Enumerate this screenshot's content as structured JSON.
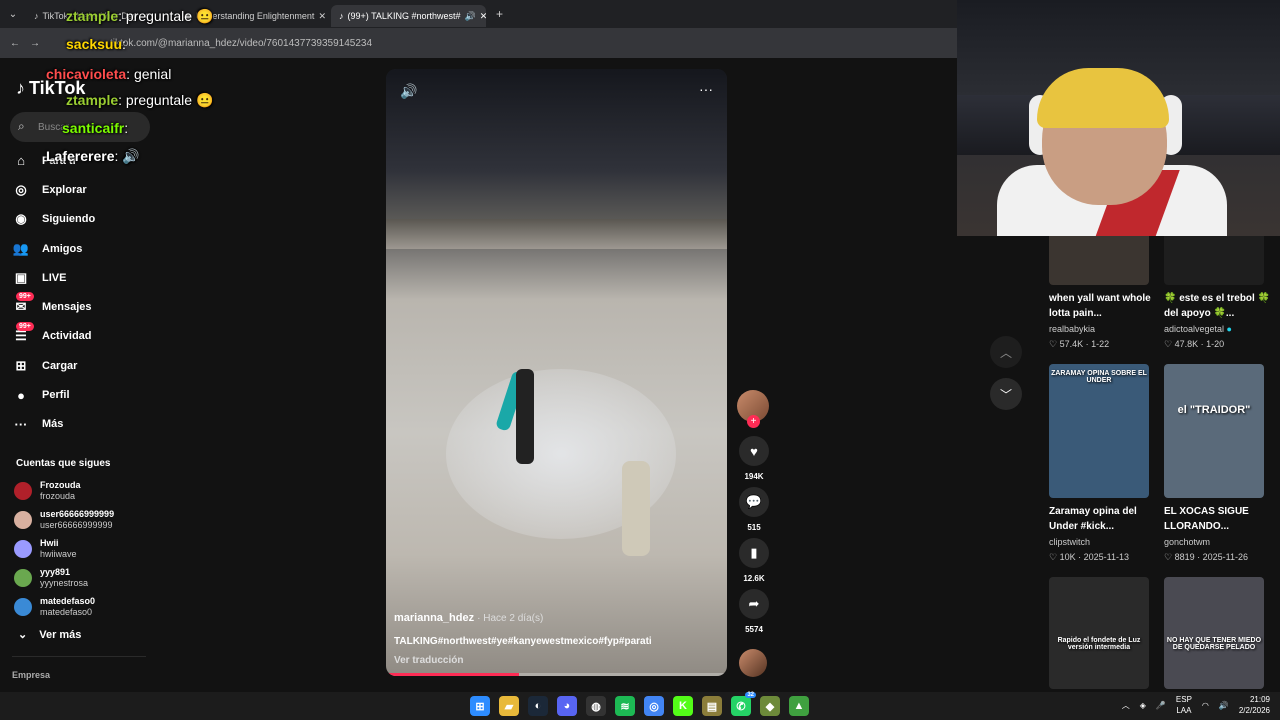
{
  "browser": {
    "tabs": [
      {
        "label": "TikTok - Make Your Day"
      },
      {
        "label": "Understanding Enlightenment"
      },
      {
        "label": "(99+) TALKING #northwest#"
      }
    ],
    "url": "tiktok.com/@marianna_hdez/video/7601437739359145234"
  },
  "chat": [
    {
      "user": "ztample",
      "msg": "preguntale 😐",
      "color": "#9acd32"
    },
    {
      "user": "sacksuu",
      "msg": "",
      "color": "#ffd700"
    },
    {
      "user": "chicavioleta",
      "msg": "genial",
      "color": "#ff4d4d"
    },
    {
      "user": "ztample",
      "msg": "preguntale 😐",
      "color": "#9acd32"
    },
    {
      "user": "santicaifr",
      "msg": "",
      "color": "#7cfc00"
    },
    {
      "user": "Lafererere",
      "msg": "🔊",
      "color": "#ffffff"
    }
  ],
  "sidebar": {
    "logo": "TikTok",
    "search_placeholder": "Buscar",
    "items": [
      {
        "label": "Para ti",
        "icon": "home-icon",
        "glyph": "⌂",
        "badge": ""
      },
      {
        "label": "Explorar",
        "icon": "compass-icon",
        "glyph": "◎",
        "badge": ""
      },
      {
        "label": "Siguiendo",
        "icon": "following-icon",
        "glyph": "◉",
        "badge": ""
      },
      {
        "label": "Amigos",
        "icon": "friends-icon",
        "glyph": "👥",
        "badge": ""
      },
      {
        "label": "LIVE",
        "icon": "live-icon",
        "glyph": "▣",
        "badge": ""
      },
      {
        "label": "Mensajes",
        "icon": "messages-icon",
        "glyph": "✉",
        "badge": "99+"
      },
      {
        "label": "Actividad",
        "icon": "activity-icon",
        "glyph": "☰",
        "badge": "99+"
      },
      {
        "label": "Cargar",
        "icon": "upload-icon",
        "glyph": "⊞",
        "badge": ""
      },
      {
        "label": "Perfil",
        "icon": "profile-icon",
        "glyph": "●",
        "badge": ""
      },
      {
        "label": "Más",
        "icon": "more-icon",
        "glyph": "···",
        "badge": ""
      }
    ],
    "following_title": "Cuentas que sigues",
    "following": [
      {
        "name": "Frozouda",
        "handle": "frozouda",
        "color": "#b0202a"
      },
      {
        "name": "user66666999999",
        "handle": "user66666999999",
        "color": "#d8b0a0"
      },
      {
        "name": "Hwii",
        "handle": "hwiiwave",
        "color": "#9a9aff"
      },
      {
        "name": "yyy891",
        "handle": "yyynestrosa",
        "color": "#6aa84f"
      },
      {
        "name": "matedefaso0",
        "handle": "matedefaso0",
        "color": "#3a8ad6"
      }
    ],
    "see_more": "Ver más",
    "footer": "Empresa"
  },
  "video": {
    "username": "marianna_hdez",
    "ago": "· Hace 2 día(s)",
    "caption": "TALKING#northwest#ye#kanyewestmexico#fyp#parati",
    "translate": "Ver traducción",
    "progress": 0.39,
    "likes": "194K",
    "comments": "515",
    "saves": "12.6K",
    "shares": "5574"
  },
  "recommended": [
    {
      "title": "when yall want whole lotta pain...",
      "author": "realbabykia",
      "likes": "57.4K",
      "meta": "1-22",
      "verified": false,
      "bg": "#3b3530",
      "overlay": ""
    },
    {
      "title": "🍀 este es el trebol 🍀 del apoyo 🍀...",
      "author": "adictoalvegetal",
      "likes": "47.8K",
      "meta": "1-20",
      "verified": true,
      "bg": "#1e1e1e",
      "overlay": ""
    },
    {
      "title": "Zaramay opina del Under #kick...",
      "author": "clipstwitch",
      "likes": "10K",
      "meta": "2025-11-13",
      "verified": false,
      "bg": "#3a5a78",
      "overlay": "ZARAMAY OPINA SOBRE EL UNDER"
    },
    {
      "title": "EL XOCAS SIGUE LLORANDO...",
      "author": "gonchotwm",
      "likes": "8819",
      "meta": "2025-11-26",
      "verified": false,
      "bg": "#5a6a7a",
      "overlay": "el \"TRAIDOR\""
    },
    {
      "title": "",
      "author": "",
      "likes": "",
      "meta": "",
      "verified": false,
      "bg": "#2a2a2a",
      "overlay": "Rapido el fondete de Luz versión intermedia"
    },
    {
      "title": "",
      "author": "",
      "likes": "",
      "meta": "",
      "verified": false,
      "bg": "#4a4a52",
      "overlay": "NO HAY QUE TENER MIEDO DE QUEDARSE PELADO"
    }
  ],
  "taskbar": {
    "apps": [
      {
        "icon": "windows-start-icon",
        "glyph": "⊞",
        "color": "#2d8cff"
      },
      {
        "icon": "file-explorer-icon",
        "glyph": "▰",
        "color": "#e8b93a"
      },
      {
        "icon": "steam-icon",
        "glyph": "◐",
        "color": "#1b2838"
      },
      {
        "icon": "discord-icon",
        "glyph": "◕",
        "color": "#5865f2"
      },
      {
        "icon": "obs-icon",
        "glyph": "◍",
        "color": "#333333"
      },
      {
        "icon": "spotify-icon",
        "glyph": "≋",
        "color": "#1db954"
      },
      {
        "icon": "chrome-icon",
        "glyph": "◎",
        "color": "#4285f4"
      },
      {
        "icon": "kick-icon",
        "glyph": "K",
        "color": "#53fc18"
      },
      {
        "icon": "chess-icon",
        "glyph": "▤",
        "color": "#8b7d3a"
      },
      {
        "icon": "whatsapp-icon",
        "glyph": "✆",
        "color": "#25d366"
      },
      {
        "icon": "game-icon",
        "glyph": "◆",
        "color": "#6d8a3a"
      },
      {
        "icon": "minecraft-icon",
        "glyph": "▲",
        "color": "#3fa03f"
      }
    ],
    "whatsapp_badge": "32",
    "lang": "ESP",
    "lang_sub": "LAA",
    "time": "21:09",
    "date": "2/2/2026"
  },
  "colors": {
    "accent": "#fe2c55",
    "bg": "#121212"
  }
}
